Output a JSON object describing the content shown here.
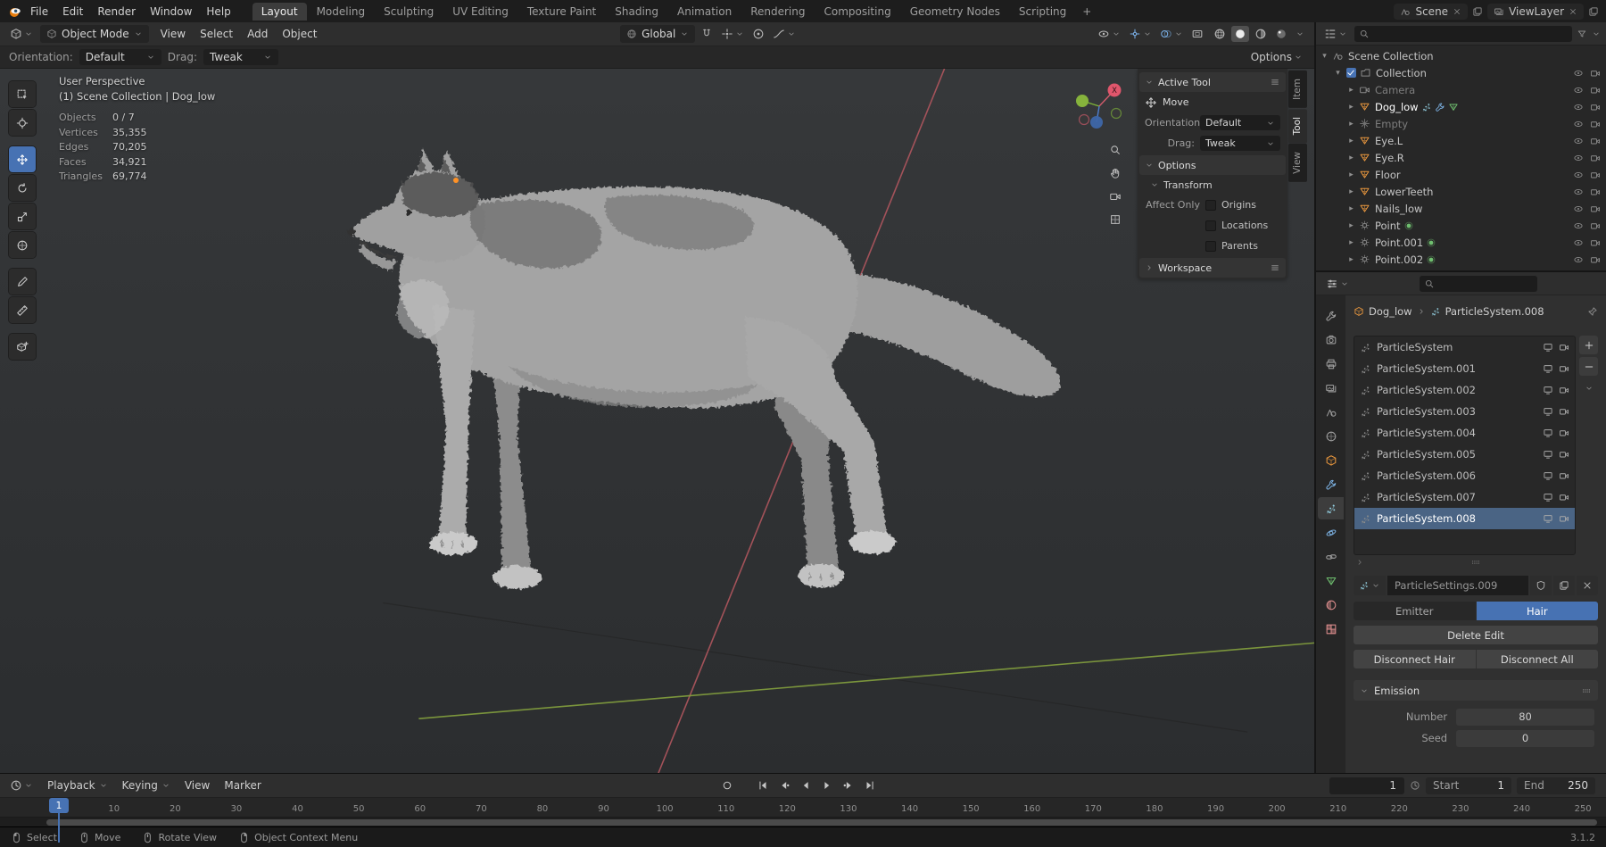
{
  "palette": {
    "accent": "#4772b3",
    "axis_x": "#b0565e",
    "axis_y": "#84a13e",
    "active_object_color": "#ff9226"
  },
  "topbar": {
    "menus": [
      "File",
      "Edit",
      "Render",
      "Window",
      "Help"
    ],
    "workspaces": [
      "Layout",
      "Modeling",
      "Sculpting",
      "UV Editing",
      "Texture Paint",
      "Shading",
      "Animation",
      "Rendering",
      "Compositing",
      "Geometry Nodes",
      "Scripting"
    ],
    "active_workspace": "Layout",
    "add_workspace": "+",
    "scene_name": "Scene",
    "viewlayer_name": "ViewLayer"
  },
  "viewport": {
    "header": {
      "mode": "Object Mode",
      "menus": [
        "View",
        "Select",
        "Add",
        "Object"
      ],
      "orientation": "Global",
      "right_toggle_icons": [
        "visibility",
        "gizmo",
        "overlays",
        "xray"
      ],
      "shading_modes": [
        "wireframe",
        "solid",
        "material",
        "rendered"
      ],
      "active_shading": "solid"
    },
    "tool_header": {
      "orientation_label": "Orientation:",
      "orientation_value": "Default",
      "drag_label": "Drag:",
      "drag_value": "Tweak",
      "options_label": "Options"
    },
    "tools": [
      "select-box",
      "cursor",
      "move",
      "rotate",
      "scale",
      "transform",
      "annotate",
      "measure",
      "add-cube"
    ],
    "active_tool": "move",
    "overlay": {
      "view_label": "User Perspective",
      "context_label": "(1) Scene Collection | Dog_low",
      "stats": [
        {
          "label": "Objects",
          "value": "0 / 7"
        },
        {
          "label": "Vertices",
          "value": "35,355"
        },
        {
          "label": "Edges",
          "value": "70,205"
        },
        {
          "label": "Faces",
          "value": "34,921"
        },
        {
          "label": "Triangles",
          "value": "69,774"
        }
      ]
    },
    "gizmo_axis_label": "X",
    "side_icons": [
      "zoom",
      "hand",
      "camera",
      "grid"
    ]
  },
  "sidebar": {
    "tabs": [
      "Item",
      "Tool",
      "View"
    ],
    "active_tab": "Tool",
    "active_tool": {
      "title": "Active Tool",
      "tool": "Move",
      "orientation_label": "Orientation",
      "orientation_value": "Default",
      "drag_label": "Drag:",
      "drag_value": "Tweak"
    },
    "options": {
      "title": "Options",
      "transform_title": "Transform",
      "affect_only": "Affect Only",
      "toggles": [
        "Origins",
        "Locations",
        "Parents"
      ]
    },
    "workspace_title": "Workspace"
  },
  "outliner": {
    "scene_collection": "Scene Collection",
    "collection": "Collection",
    "items": [
      {
        "name": "Camera",
        "icon": "camera",
        "dim": true
      },
      {
        "name": "Dog_low",
        "icon": "mesh",
        "active": true,
        "extras": [
          "particles",
          "modifier",
          "mesh-data"
        ]
      },
      {
        "name": "Empty",
        "icon": "empty",
        "dim": true
      },
      {
        "name": "Eye.L",
        "icon": "mesh"
      },
      {
        "name": "Eye.R",
        "icon": "mesh"
      },
      {
        "name": "Floor",
        "icon": "mesh"
      },
      {
        "name": "LowerTeeth",
        "icon": "mesh"
      },
      {
        "name": "Nails_low",
        "icon": "mesh"
      },
      {
        "name": "Point",
        "icon": "light",
        "extras": [
          "light-data"
        ]
      },
      {
        "name": "Point.001",
        "icon": "light",
        "extras": [
          "light-data"
        ]
      },
      {
        "name": "Point.002",
        "icon": "light",
        "extras": [
          "light-data"
        ]
      },
      {
        "name": "",
        "icon": "mesh",
        "partial": true
      }
    ]
  },
  "properties": {
    "tabs": [
      "tool",
      "render",
      "output",
      "view-layer",
      "scene",
      "world",
      "object",
      "modifiers",
      "particles",
      "physics",
      "constraints",
      "object-data",
      "material",
      "texture"
    ],
    "active_tab": "particles",
    "breadcrumb": {
      "object": "Dog_low",
      "item": "ParticleSystem.008"
    },
    "particle_systems": [
      "ParticleSystem",
      "ParticleSystem.001",
      "ParticleSystem.002",
      "ParticleSystem.003",
      "ParticleSystem.004",
      "ParticleSystem.005",
      "ParticleSystem.006",
      "ParticleSystem.007",
      "ParticleSystem.008"
    ],
    "selected_system": "ParticleSystem.008",
    "settings_name": "ParticleSettings.009",
    "type_options": [
      "Emitter",
      "Hair"
    ],
    "active_type": "Hair",
    "delete_edit_label": "Delete Edit",
    "disconnect_hair_label": "Disconnect Hair",
    "disconnect_all_label": "Disconnect All",
    "emission_title": "Emission",
    "emission_fields": [
      {
        "label": "Number",
        "value": "80"
      },
      {
        "label": "Seed",
        "value": "0"
      }
    ]
  },
  "timeline": {
    "menus": [
      "Playback",
      "Keying",
      "View",
      "Marker"
    ],
    "transport_icons": [
      "jump-start",
      "key-prev",
      "play-reverse",
      "play",
      "key-next",
      "jump-end"
    ],
    "current_frame": "1",
    "start_label": "Start",
    "start_value": "1",
    "end_label": "End",
    "end_value": "250",
    "frame_ticks": [
      1,
      10,
      20,
      30,
      40,
      50,
      60,
      70,
      80,
      90,
      100,
      110,
      120,
      130,
      140,
      150,
      160,
      170,
      180,
      190,
      200,
      210,
      220,
      230,
      240,
      250
    ]
  },
  "status_bar": {
    "hints": [
      {
        "icon": "mouse-left",
        "label": "Select"
      },
      {
        "icon": "mouse-middle",
        "label": "Move"
      },
      {
        "icon": "mouse-middle",
        "label": "Rotate View"
      },
      {
        "icon": "mouse-right",
        "label": "Object Context Menu"
      }
    ],
    "version": "3.1.2"
  }
}
